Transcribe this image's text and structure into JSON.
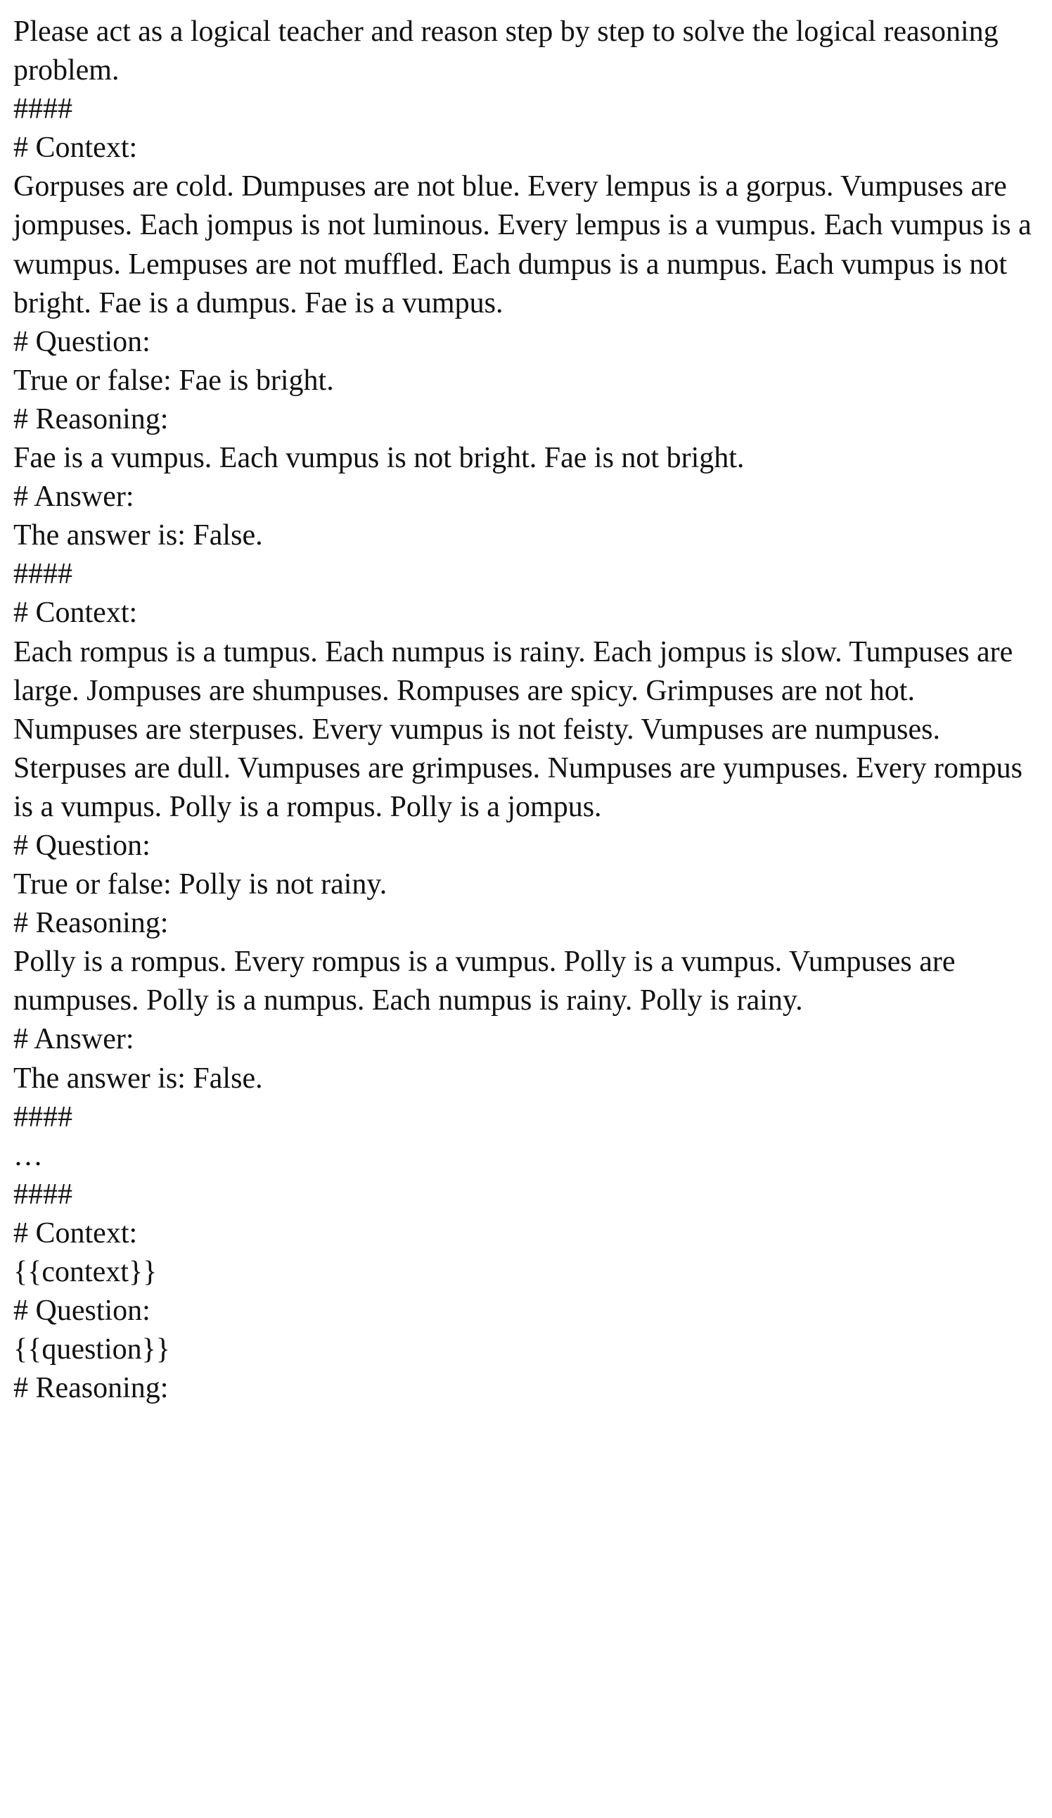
{
  "prompt": {
    "intro": "Please act as a logical teacher and reason step by step to solve the logical reasoning problem.",
    "separator": "####",
    "ellipsis": "…",
    "context_header": "# Context:",
    "question_header": "# Question:",
    "reasoning_header": "# Reasoning:",
    "answer_header": "# Answer:",
    "examples": [
      {
        "context": "Gorpuses are cold. Dumpuses are not blue. Every lempus is a gorpus. Vumpuses are jompuses. Each jompus is not luminous. Every lempus is a vumpus. Each vumpus is a wumpus. Lempuses are not muffled. Each dumpus is a numpus. Each vumpus is not bright. Fae is a dumpus. Fae is a vumpus.",
        "question": "True or false: Fae is bright.",
        "reasoning": "Fae is a vumpus. Each vumpus is not bright. Fae is not bright.",
        "answer": "The answer is: False."
      },
      {
        "context": "Each rompus is a tumpus. Each numpus is rainy. Each jompus is slow. Tumpuses are large. Jompuses are shumpuses. Rompuses are spicy. Grimpuses are not hot. Numpuses are sterpuses. Every vumpus is not feisty. Vumpuses are numpuses. Sterpuses are dull. Vumpuses are grimpuses. Numpuses are yumpuses. Every rompus is a vumpus. Polly is a rompus. Polly is a jompus.",
        "question": "True or false: Polly is not rainy.",
        "reasoning": "Polly is a rompus. Every rompus is a vumpus. Polly is a vumpus. Vumpuses are numpuses. Polly is a numpus. Each numpus is rainy. Polly is rainy.",
        "answer": "The answer is: False."
      }
    ],
    "template": {
      "context": "{{context}}",
      "question": "{{question}}"
    }
  }
}
